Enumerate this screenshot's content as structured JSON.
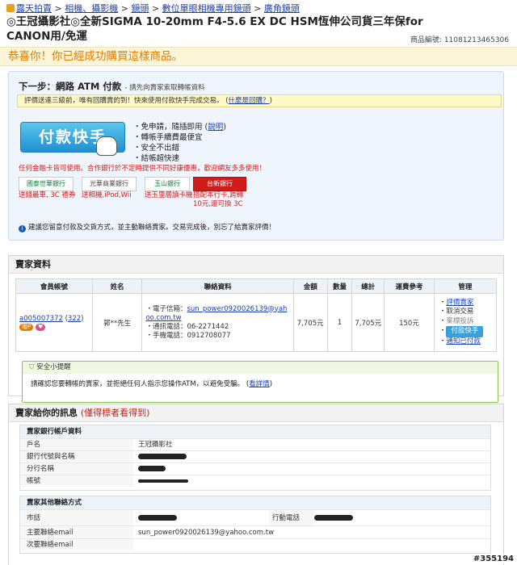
{
  "breadcrumb": {
    "items": [
      "露天拍賣",
      "相機、攝影機",
      "鏡頭",
      "數位單眼相機專用鏡頭",
      "廣角鏡頭"
    ],
    "sep": ">"
  },
  "product": {
    "title": "◎王冠攝影社◎全新SIGMA 10-20mm F4-5.6 EX DC HSM恆伸公司貨三年保for CANON用/免運",
    "id_label": "商品編號:",
    "id": "11081213465306"
  },
  "congrats": "恭喜你！你已經成功購買這樣商品。",
  "next_step": {
    "title": "下一步：網路 ATM 付款",
    "subtitle": "- 請先向賣家索取轉帳資料",
    "warning": "評價送達三級前，唯有回購賣的到！快來使用付款快手完成交易。",
    "warning_link": "什麼是回購？",
    "pay_button": "付款快手",
    "features": [
      "免申請，隨插即用",
      "轉帳手續費最便宜",
      "安全不出錯",
      "結帳超快速"
    ],
    "explain_link": "說明",
    "bank_note": "任何金融卡皆可使用。合作銀行於不定時提供不同好康優惠，歡迎網友多多使用！",
    "banks": [
      {
        "name": "國泰世華銀行",
        "promo": "送錢最車, 3C 禮券"
      },
      {
        "name": "光華商業銀行",
        "promo": "送相機,iPod,Wii"
      },
      {
        "name": "玉山銀行",
        "promo": "送玉里居讀卡機"
      },
      {
        "name": "台新銀行",
        "promo": "搭配本行卡,跨轉 10元,還可換 3C"
      }
    ],
    "suggestion": "建議您留意付款及交貨方式，並主動聯絡賣家。交易完成後，別忘了給賣家評價！"
  },
  "seller_info": {
    "header": "賣家資料",
    "columns": [
      "會員帳號",
      "姓名",
      "聯絡資料",
      "金額",
      "數量",
      "總計",
      "運費參考",
      "管理"
    ],
    "member_id": "a005007372",
    "rating": "322",
    "badge1": "贈P",
    "badge2": "♥",
    "name": "郭**先生",
    "email_label": "電子信箱：",
    "email": "sun_power0920026139@yahoo.com.tw",
    "phone_label": "通訊電話：",
    "phone": "06-2271442",
    "mobile_label": "手機電話：",
    "mobile": "0912708077",
    "amount": "7,705元",
    "qty": "1",
    "total": "7,705元",
    "shipping": "150元",
    "manage": [
      "評價賣家",
      "取消交易",
      "棄標投訴",
      "付款快手",
      "通知已付款"
    ]
  },
  "safety": {
    "title": "安全小提醒",
    "text": "請確認您要轉帳的賣家，並拒絕任何人指示您操作ATM，以避免受騙。",
    "link": "看詳情"
  },
  "seller_msg": {
    "header": "賣家給你的訊息",
    "note": "(僅得標者看得到)",
    "bank_title": "賣家銀行帳戶資料",
    "bank_rows": [
      {
        "k": "戶名",
        "v": "王冠攝影社"
      },
      {
        "k": "銀行代號與名稱",
        "v": ""
      },
      {
        "k": "分行名稱",
        "v": ""
      },
      {
        "k": "帳號",
        "v": ""
      }
    ],
    "contact_title": "賣家其他聯絡方式",
    "contact_rows": [
      {
        "k": "市話",
        "v": "",
        "k2": "行動電話"
      },
      {
        "k": "主要聯絡email",
        "v": "sun_power0920026139@yahoo.com.tw"
      },
      {
        "k": "次要聯絡email",
        "v": ""
      }
    ]
  },
  "watermark": "#355194"
}
